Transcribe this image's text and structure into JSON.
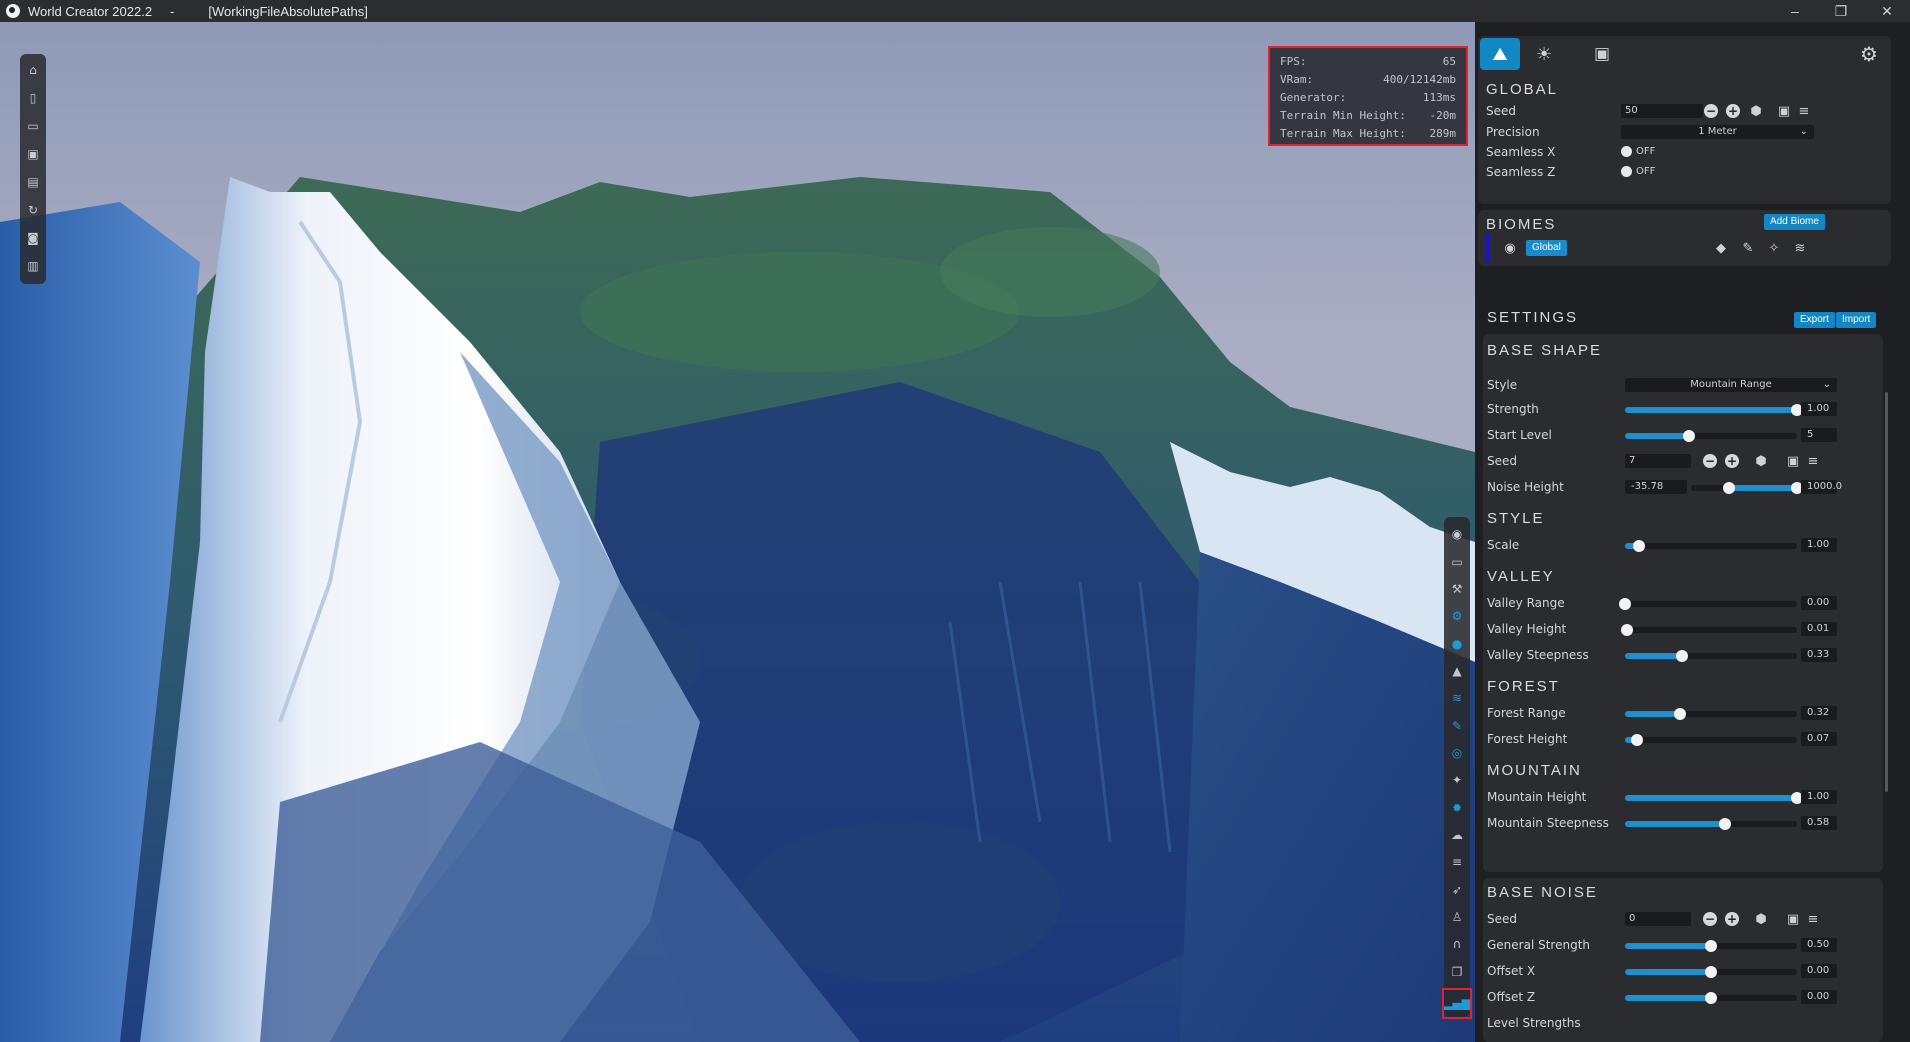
{
  "titlebar": {
    "app_name": "World Creator 2022.2",
    "separator": "-",
    "file": "[WorkingFileAbsolutePaths]"
  },
  "stats": [
    {
      "label": "FPS:",
      "value": "65"
    },
    {
      "label": "VRam:",
      "value": "400/12142mb"
    },
    {
      "label": "Generator:",
      "value": "113ms"
    },
    {
      "label": "Terrain Min Height:",
      "value": "-20m"
    },
    {
      "label": "Terrain Max Height:",
      "value": "289m"
    }
  ],
  "global": {
    "title": "GLOBAL",
    "seed_label": "Seed",
    "seed_value": "50",
    "precision_label": "Precision",
    "precision_value": "1 Meter",
    "seamless_x_label": "Seamless X",
    "seamless_x_value": "OFF",
    "seamless_z_label": "Seamless Z",
    "seamless_z_value": "OFF"
  },
  "biomes": {
    "title": "BIOMES",
    "add_label": "Add Biome",
    "item_label": "Global",
    "item_color": "#1a10d8"
  },
  "settings": {
    "title": "SETTINGS",
    "export_label": "Export",
    "import_label": "Import"
  },
  "base_shape": {
    "title": "BASE  SHAPE",
    "style_label": "Style",
    "style_value": "Mountain Range",
    "strength_label": "Strength",
    "strength_value": "1.00",
    "strength_level": 1.0,
    "start_level_label": "Start Level",
    "start_level_value": "5",
    "start_level_fill": 0.37,
    "seed_label": "Seed",
    "seed_value": "7",
    "noise_height_label": "Noise Height",
    "noise_height_min": "-35.78",
    "noise_height_max": "1000.0"
  },
  "style": {
    "title": "STYLE",
    "scale_label": "Scale",
    "scale_value": "1.00",
    "scale_level": 0.08
  },
  "valley": {
    "title": "VALLEY",
    "range_label": "Valley Range",
    "range_value": "0.00",
    "height_label": "Valley Height",
    "height_value": "0.01",
    "steepness_label": "Valley Steepness",
    "steepness_value": "0.33"
  },
  "forest": {
    "title": "FOREST",
    "range_label": "Forest Range",
    "range_value": "0.32",
    "height_label": "Forest Height",
    "height_value": "0.07"
  },
  "mountain": {
    "title": "MOUNTAIN",
    "height_label": "Mountain Height",
    "height_value": "1.00",
    "steepness_label": "Mountain Steepness",
    "steepness_value": "0.58"
  },
  "base_noise": {
    "title": "BASE  NOISE",
    "seed_label": "Seed",
    "seed_value": "0",
    "general_strength_label": "General Strength",
    "general_strength_value": "0.50",
    "offset_x_label": "Offset X",
    "offset_x_value": "0.00",
    "offset_z_label": "Offset Z",
    "offset_z_value": "0.00",
    "level_strengths_label": "Level Strengths"
  },
  "colors": {
    "accent": "#1f8fd0",
    "highlight_border": "#e0232e"
  }
}
